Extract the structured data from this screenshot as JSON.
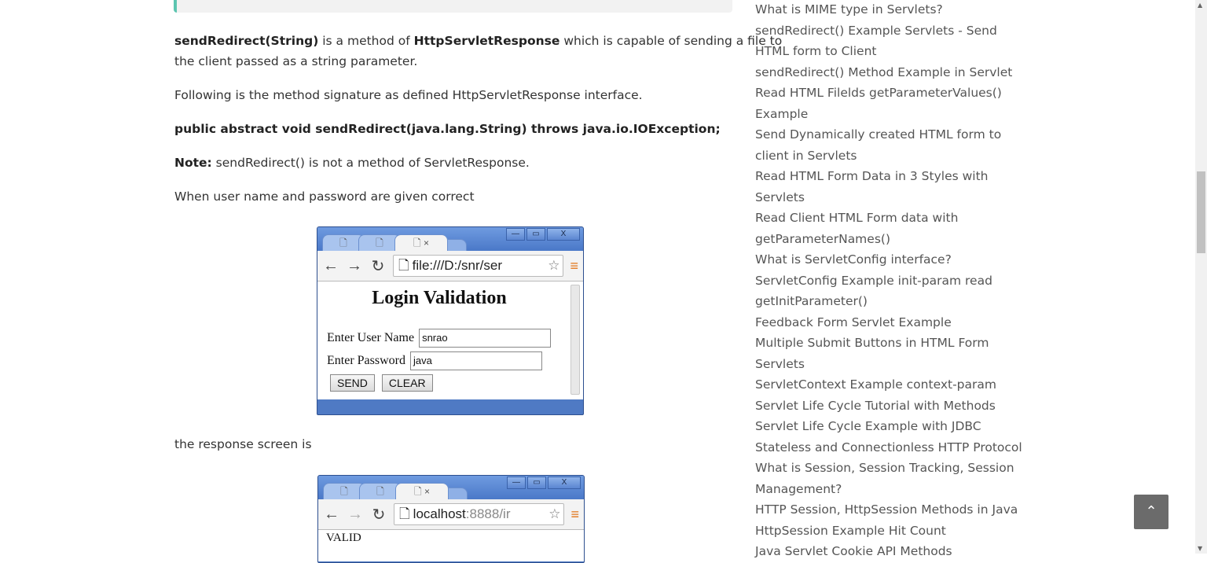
{
  "article": {
    "p1": {
      "b1": "sendRedirect(String)",
      "t1": " is a method of ",
      "b2": "HttpServletResponse",
      "t2": " which is capable of sending a file to",
      "line2": "the client passed as a string parameter."
    },
    "p2": "Following is the method signature as defined HttpServletResponse interface.",
    "p3": "public abstract void sendRedirect(java.lang.String) throws java.io.IOException;",
    "p4": {
      "label": "Note:",
      "text": " sendRedirect() is not a method of ServletResponse."
    },
    "p5": "When user name and password are given correct",
    "p6": "the response screen is"
  },
  "window1": {
    "ctrl_min": "—",
    "ctrl_max": "▭",
    "ctrl_close": "X",
    "tab_icon": "🗋",
    "tab_close": "×",
    "url": "file:///D:/snr/ser",
    "title": "Login Validation",
    "username_label": "Enter User Name",
    "username_value": "snrao",
    "password_label": "Enter Password",
    "password_value": "java",
    "send_label": "SEND",
    "clear_label": "CLEAR"
  },
  "window2": {
    "url_host": "localhost",
    "url_rest": ":8888/ir",
    "content_partial": "VALID"
  },
  "sidebar": {
    "links": [
      "What is MIME type in Servlets?",
      "sendRedirect() Example Servlets - Send",
      "HTML form to Client",
      "sendRedirect() Method Example in Servlet",
      "Read HTML Filelds getParameterValues()",
      "Example",
      "Send Dynamically created HTML form to",
      "client in Servlets",
      "Read HTML Form Data in 3 Styles with",
      "Servlets",
      "Read Client HTML Form data with",
      "getParameterNames()",
      "What is ServletConfig interface?",
      "ServletConfig Example init-param read",
      "getInitParameter()",
      "Feedback Form Servlet Example",
      "Multiple Submit Buttons in HTML Form",
      "Servlets",
      "ServletContext Example context-param",
      "Servlet Life Cycle Tutorial with Methods",
      "Servlet Life Cycle Example with JDBC",
      "Stateless and Connectionless HTTP Protocol",
      "What is Session, Session Tracking, Session",
      "Management?",
      "HTTP Session, HttpSession Methods in Java",
      "HttpSession Example Hit Count",
      "Java Servlet Cookie API Methods"
    ]
  },
  "back_to_top_icon": "chevron-up-icon"
}
